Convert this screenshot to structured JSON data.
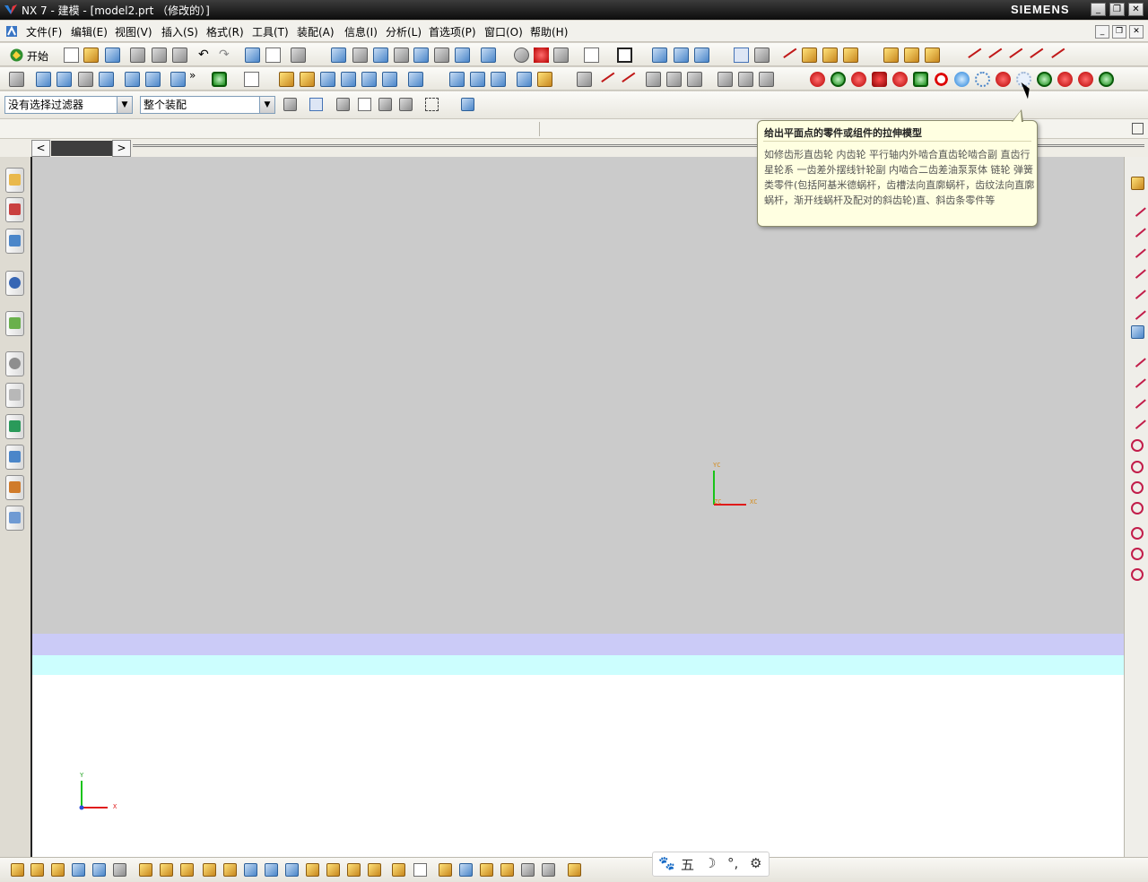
{
  "window": {
    "title": "NX 7 - 建模 - [model2.prt （修改的）]",
    "brand": "SIEMENS",
    "controls": [
      "_",
      "❐",
      "✕"
    ],
    "mdi_controls": [
      "_",
      "❐",
      "✕"
    ]
  },
  "menu": [
    "文件(F)",
    "编辑(E)",
    "视图(V)",
    "插入(S)",
    "格式(R)",
    "工具(T)",
    "装配(A)",
    "信息(I)",
    "分析(L)",
    "首选项(P)",
    "窗口(O)",
    "帮助(H)"
  ],
  "toolbar": {
    "start_label": "开始",
    "overflow": "»"
  },
  "selection_bar": {
    "type_filter": "没有选择过滤器",
    "scope": "整个装配"
  },
  "tab_nav": {
    "prev": "<",
    "next": ">"
  },
  "tooltip": {
    "title": "给出平面点的零件或组件的拉伸模型",
    "body": "如修齿形直齿轮 内齿轮 平行轴内外啮合直齿轮啮合副 直齿行星轮系 一齿差外摆线针轮副 内啮合二齿差油泵泵体 链轮 弹簧类零件(包括阿基米德蜗杆，齿槽法向直廓蜗杆，齿纹法向直廓蜗杆，渐开线蜗杆及配对的斜齿轮)直、斜齿条零件等"
  },
  "wcs": {
    "view_y": "YC",
    "view_x": "XC",
    "view_z": "ZC",
    "abs_y": "Y",
    "abs_x": "X"
  },
  "ime_bar": {
    "items": [
      "🐾",
      "五",
      "☽",
      "°,",
      "⚙"
    ]
  },
  "colors": {
    "titlebar": "#1a1a1a",
    "viewport": "#cbcbcb",
    "band_lavender": "#cbcbf7",
    "band_cyan": "#ccfefe",
    "tooltip_bg": "#ffffe1"
  }
}
